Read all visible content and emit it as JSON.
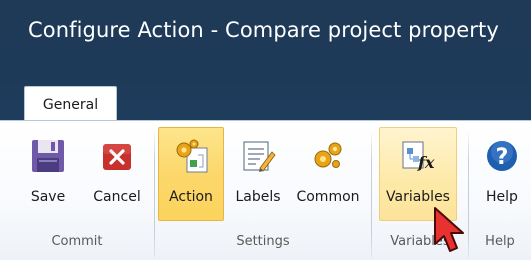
{
  "window": {
    "title": "Configure Action - Compare project property"
  },
  "tabs": [
    {
      "label": "General",
      "selected": true
    }
  ],
  "ribbon": {
    "groups": [
      {
        "label": "Commit",
        "buttons": [
          {
            "label": "Save",
            "icon": "floppy-disk-icon"
          },
          {
            "label": "Cancel",
            "icon": "close-icon"
          }
        ]
      },
      {
        "label": "Settings",
        "buttons": [
          {
            "label": "Action",
            "icon": "gears-action-icon",
            "state": "selected"
          },
          {
            "label": "Labels",
            "icon": "notepad-pencil-icon"
          },
          {
            "label": "Common",
            "icon": "gears-icon"
          }
        ]
      },
      {
        "label": "Variables",
        "buttons": [
          {
            "label": "Variables",
            "icon": "fx-function-icon",
            "state": "hover"
          }
        ]
      },
      {
        "label": "Help",
        "buttons": [
          {
            "label": "Help",
            "icon": "help-question-icon"
          }
        ]
      }
    ]
  },
  "colors": {
    "titlebar_bg": "#1e3a58",
    "ribbon_selected_bg": "#fcd76b",
    "ribbon_hover_bg": "#fde9a7",
    "save_icon": "#6e5aa8",
    "cancel_icon": "#c8302d",
    "help_icon": "#1f5fb0"
  }
}
